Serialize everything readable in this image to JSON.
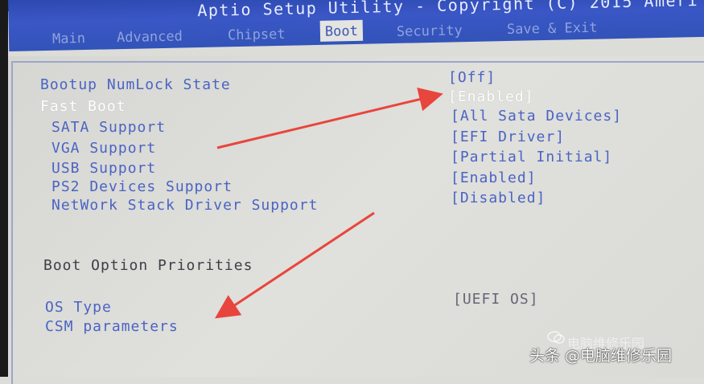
{
  "title": "Aptio Setup Utility - Copyright (C) 2015 Ameri",
  "tabs": [
    {
      "label": "Main"
    },
    {
      "label": "Advanced"
    },
    {
      "label": "Chipset"
    },
    {
      "label": "Boot",
      "active": true
    },
    {
      "label": "Security"
    },
    {
      "label": "Save & Exit"
    }
  ],
  "settings": [
    {
      "label": "Bootup NumLock State",
      "value": "[Off]"
    },
    {
      "label": "Fast Boot",
      "value": "[Enabled]"
    },
    {
      "label": "SATA Support",
      "value": "[All Sata Devices]"
    },
    {
      "label": "VGA Support",
      "value": "[EFI Driver]"
    },
    {
      "label": "USB Support",
      "value": "[Partial Initial]"
    },
    {
      "label": "PS2 Devices Support",
      "value": "[Enabled]"
    },
    {
      "label": "NetWork Stack Driver Support",
      "value": "[Disabled]"
    }
  ],
  "boot_option_priorities": "Boot Option Priorities",
  "os_type": {
    "label": "OS Type",
    "value": "[UEFI OS]"
  },
  "csm_parameters": "CSM parameters",
  "watermark": {
    "faint": "电脑维修乐园",
    "main": "头条 @电脑维修乐园"
  },
  "colors": {
    "title_bar": "#3a57c6",
    "item_text": "#4a64c4",
    "highlight_text": "#ffffff",
    "annotation_arrow": "#e8453c"
  }
}
